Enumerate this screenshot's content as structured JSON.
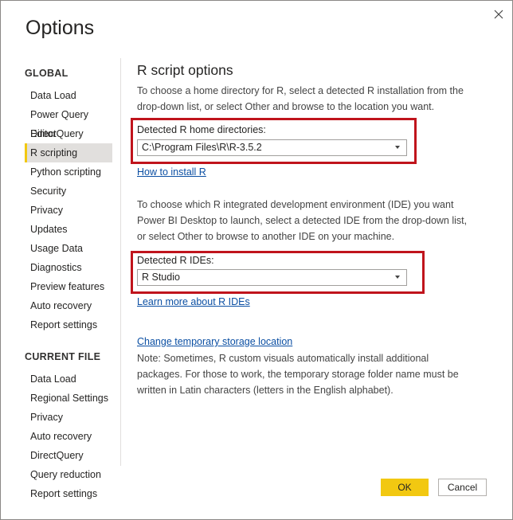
{
  "dialog": {
    "title": "Options"
  },
  "nav": {
    "global_header": "GLOBAL",
    "global_items": [
      "Data Load",
      "Power Query Editor",
      "DirectQuery",
      "R scripting",
      "Python scripting",
      "Security",
      "Privacy",
      "Updates",
      "Usage Data",
      "Diagnostics",
      "Preview features",
      "Auto recovery",
      "Report settings"
    ],
    "selected": "R scripting",
    "current_file_header": "CURRENT FILE",
    "current_file_items": [
      "Data Load",
      "Regional Settings",
      "Privacy",
      "Auto recovery",
      "DirectQuery",
      "Query reduction",
      "Report settings"
    ]
  },
  "main": {
    "section_title": "R script options",
    "intro_text": "To choose a home directory for R, select a detected R installation from the drop-down list, or select Other and browse to the location you want.",
    "home_dir_label": "Detected R home directories:",
    "home_dir_value": "C:\\Program Files\\R\\R-3.5.2",
    "install_link": "How to install R",
    "ide_text": "To choose which R integrated development environment (IDE) you want Power BI Desktop to launch, select a detected IDE from the drop-down list, or select Other to browse to another IDE on your machine.",
    "ide_label": "Detected R IDEs:",
    "ide_value": "R Studio",
    "ide_link": "Learn more about R IDEs",
    "storage_link": "Change temporary storage location",
    "note_text": "Note: Sometimes, R custom visuals automatically install additional packages. For those to work, the temporary storage folder name must be written in Latin characters (letters in the English alphabet)."
  },
  "buttons": {
    "ok": "OK",
    "cancel": "Cancel"
  },
  "colors": {
    "accent": "#f2c811",
    "highlight_box": "#c0141c",
    "link": "#0b4fa3"
  }
}
